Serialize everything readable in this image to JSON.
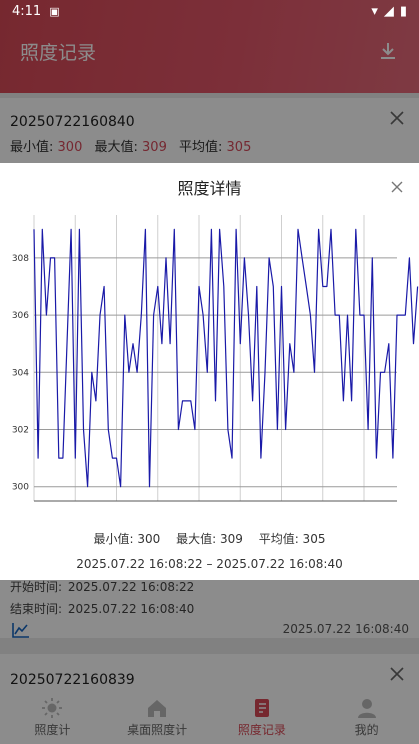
{
  "status": {
    "time": "4:11"
  },
  "header": {
    "title": "照度记录"
  },
  "cards": [
    {
      "id": "20250722160840",
      "min_label": "最小值:",
      "min_value": "300",
      "max_label": "最大值:",
      "max_value": "309",
      "avg_label": "平均值:",
      "avg_value": "305",
      "start_label": "开始时间:",
      "start_value": "2025.07.22 16:08:22",
      "end_label": "结束时间:",
      "end_value": "2025.07.22 16:08:40",
      "date": "2025.07.22 16:08:40"
    },
    {
      "id": "20250722160839"
    }
  ],
  "dialog": {
    "title": "照度详情",
    "stats": {
      "min": "最小值: 300",
      "max": "最大值: 309",
      "avg": "平均值: 305"
    },
    "range": "2025.07.22 16:08:22 – 2025.07.22 16:08:40"
  },
  "nav": [
    {
      "label": "照度计",
      "icon": "sun-icon"
    },
    {
      "label": "桌面照度计",
      "icon": "home-icon"
    },
    {
      "label": "照度记录",
      "icon": "record-icon",
      "active": true
    },
    {
      "label": "我的",
      "icon": "user-icon"
    }
  ],
  "colors": {
    "accent": "#d84a57",
    "line": "#1a1aa8"
  },
  "chart_data": {
    "type": "line",
    "xlim": [
      0,
      88
    ],
    "ylim": [
      299.5,
      309.5
    ],
    "x_ticks": [
      "0",
      "10",
      "20",
      "30",
      "40",
      "50",
      "60",
      "70",
      "80"
    ],
    "y_ticks": [
      "300",
      "302",
      "304",
      "306",
      "308"
    ],
    "grid": true,
    "series": [
      {
        "values": [
          309,
          301,
          309,
          306,
          308,
          308,
          301,
          301,
          305,
          309,
          301,
          309,
          302,
          300,
          304,
          303,
          306,
          307,
          302,
          301,
          301,
          300,
          306,
          304,
          305,
          304,
          306,
          309,
          300,
          306,
          307,
          305,
          308,
          305,
          309,
          302,
          303,
          303,
          303,
          302,
          307,
          306,
          304,
          309,
          303,
          309,
          307,
          302,
          301,
          309,
          305,
          308,
          306,
          303,
          307,
          301,
          304,
          308,
          307,
          302,
          307,
          302,
          305,
          304,
          309,
          308,
          307,
          306,
          304,
          309,
          307,
          307,
          309,
          306,
          306,
          303,
          306,
          303,
          309,
          306,
          306,
          302,
          308,
          301,
          304,
          304,
          305,
          301,
          306,
          306,
          306,
          308,
          305,
          307
        ]
      }
    ]
  }
}
